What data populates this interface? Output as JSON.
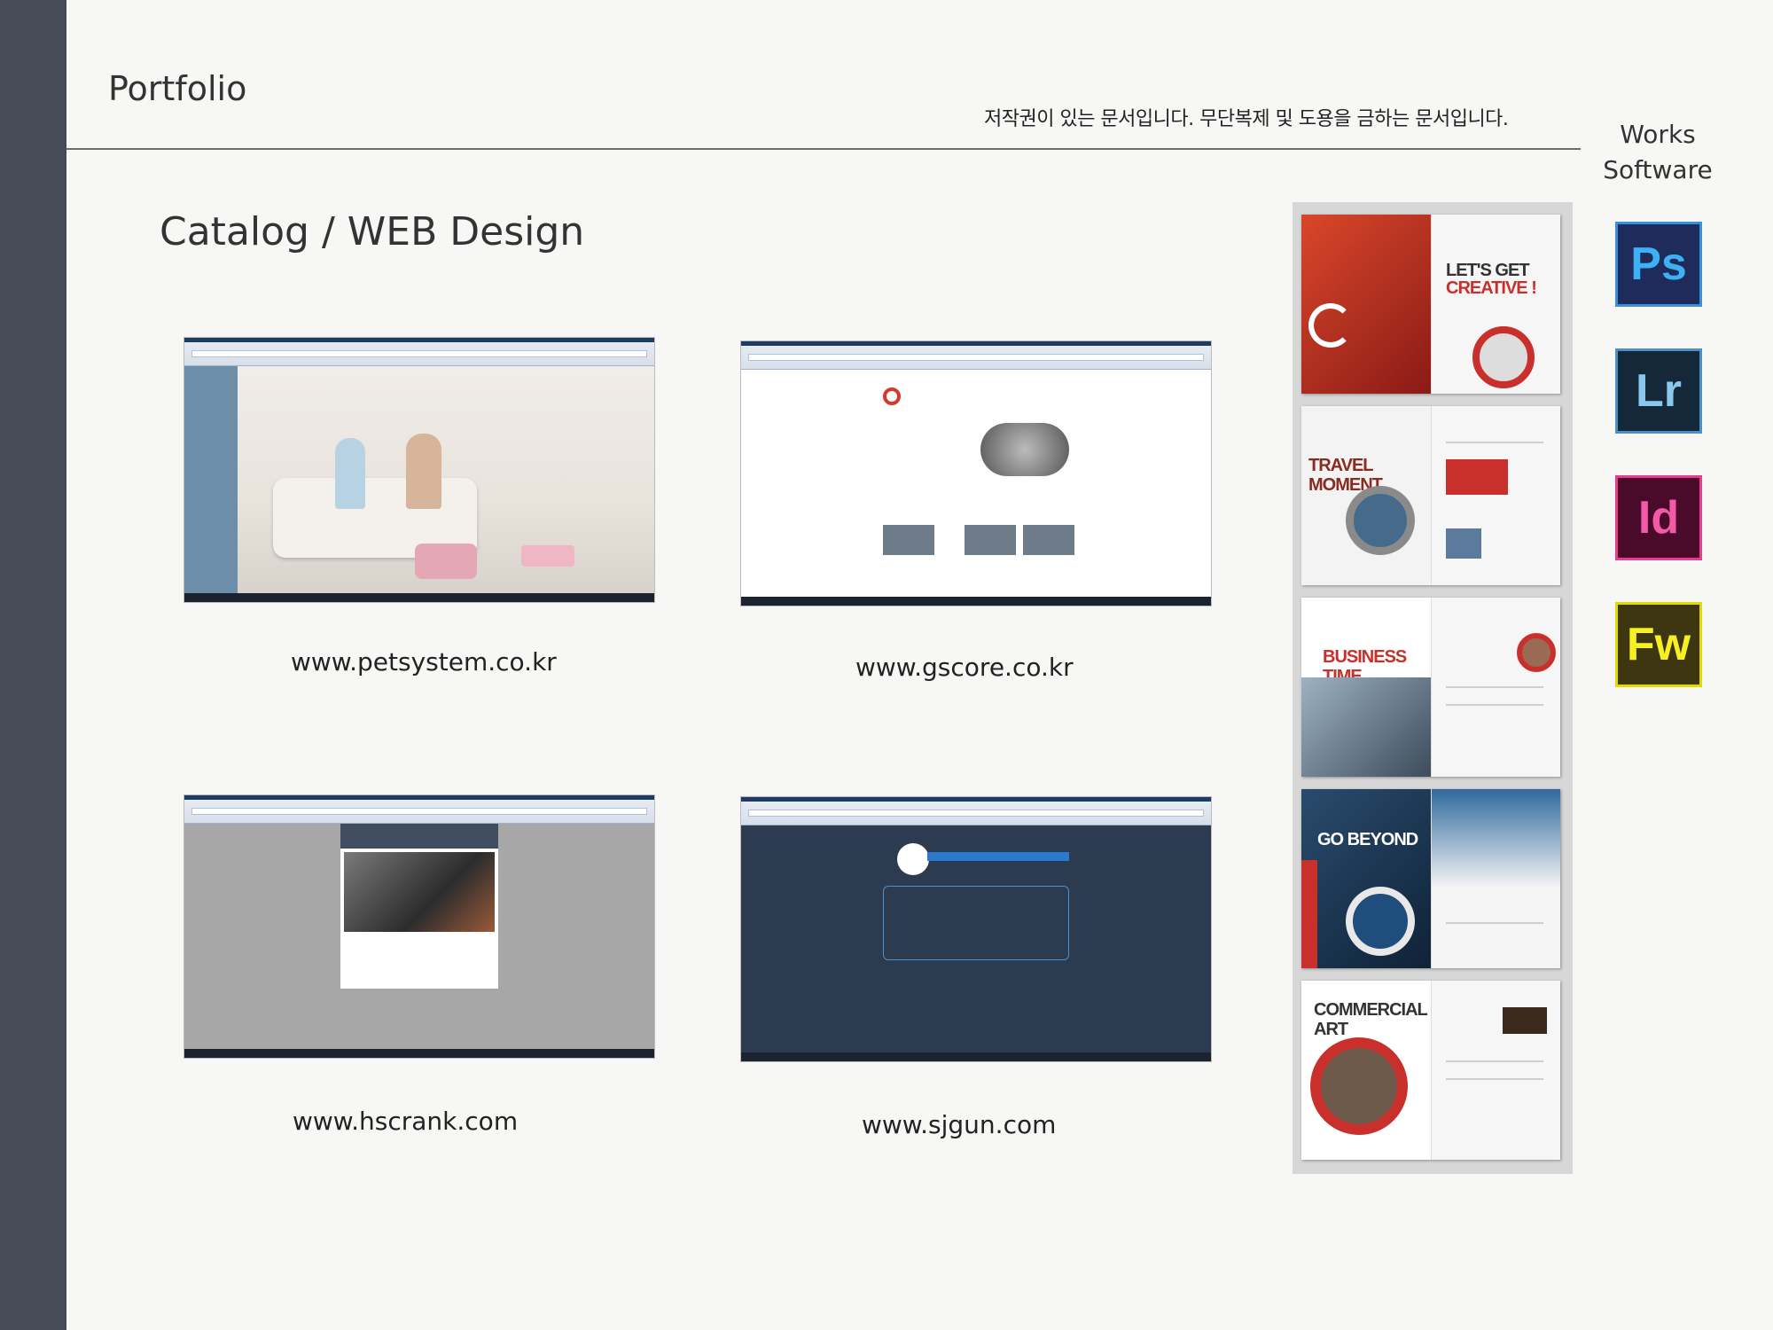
{
  "page": {
    "title": "Portfolio",
    "copyright": "저작권이 있는 문서입니다. 무단복제 및 도용을 금하는 문서입니다.",
    "works_label": "Works",
    "software_label": "Software",
    "section_title": "Catalog / WEB Design"
  },
  "websites": [
    {
      "url": "www.petsystem.co.kr"
    },
    {
      "url": "www.gscore.co.kr"
    },
    {
      "url": "www.hscrank.com"
    },
    {
      "url": "www.sjgun.com"
    }
  ],
  "catalog": [
    {
      "title_line1": "LET'S GET",
      "title_line2": "CREATIVE !"
    },
    {
      "title": "TRAVEL MOMENT"
    },
    {
      "title": "BUSINESS TIME"
    },
    {
      "title": "GO BEYOND"
    },
    {
      "title": "COMMERCIAL ART"
    }
  ],
  "software": [
    {
      "abbr": "Ps",
      "icon": "photoshop-icon"
    },
    {
      "abbr": "Lr",
      "icon": "lightroom-icon"
    },
    {
      "abbr": "Id",
      "icon": "indesign-icon"
    },
    {
      "abbr": "Fw",
      "icon": "fireworks-icon"
    }
  ],
  "colors": {
    "sidebar": "#454c58",
    "background": "#f7f7f5",
    "catalog_accent": "#c9302c"
  }
}
